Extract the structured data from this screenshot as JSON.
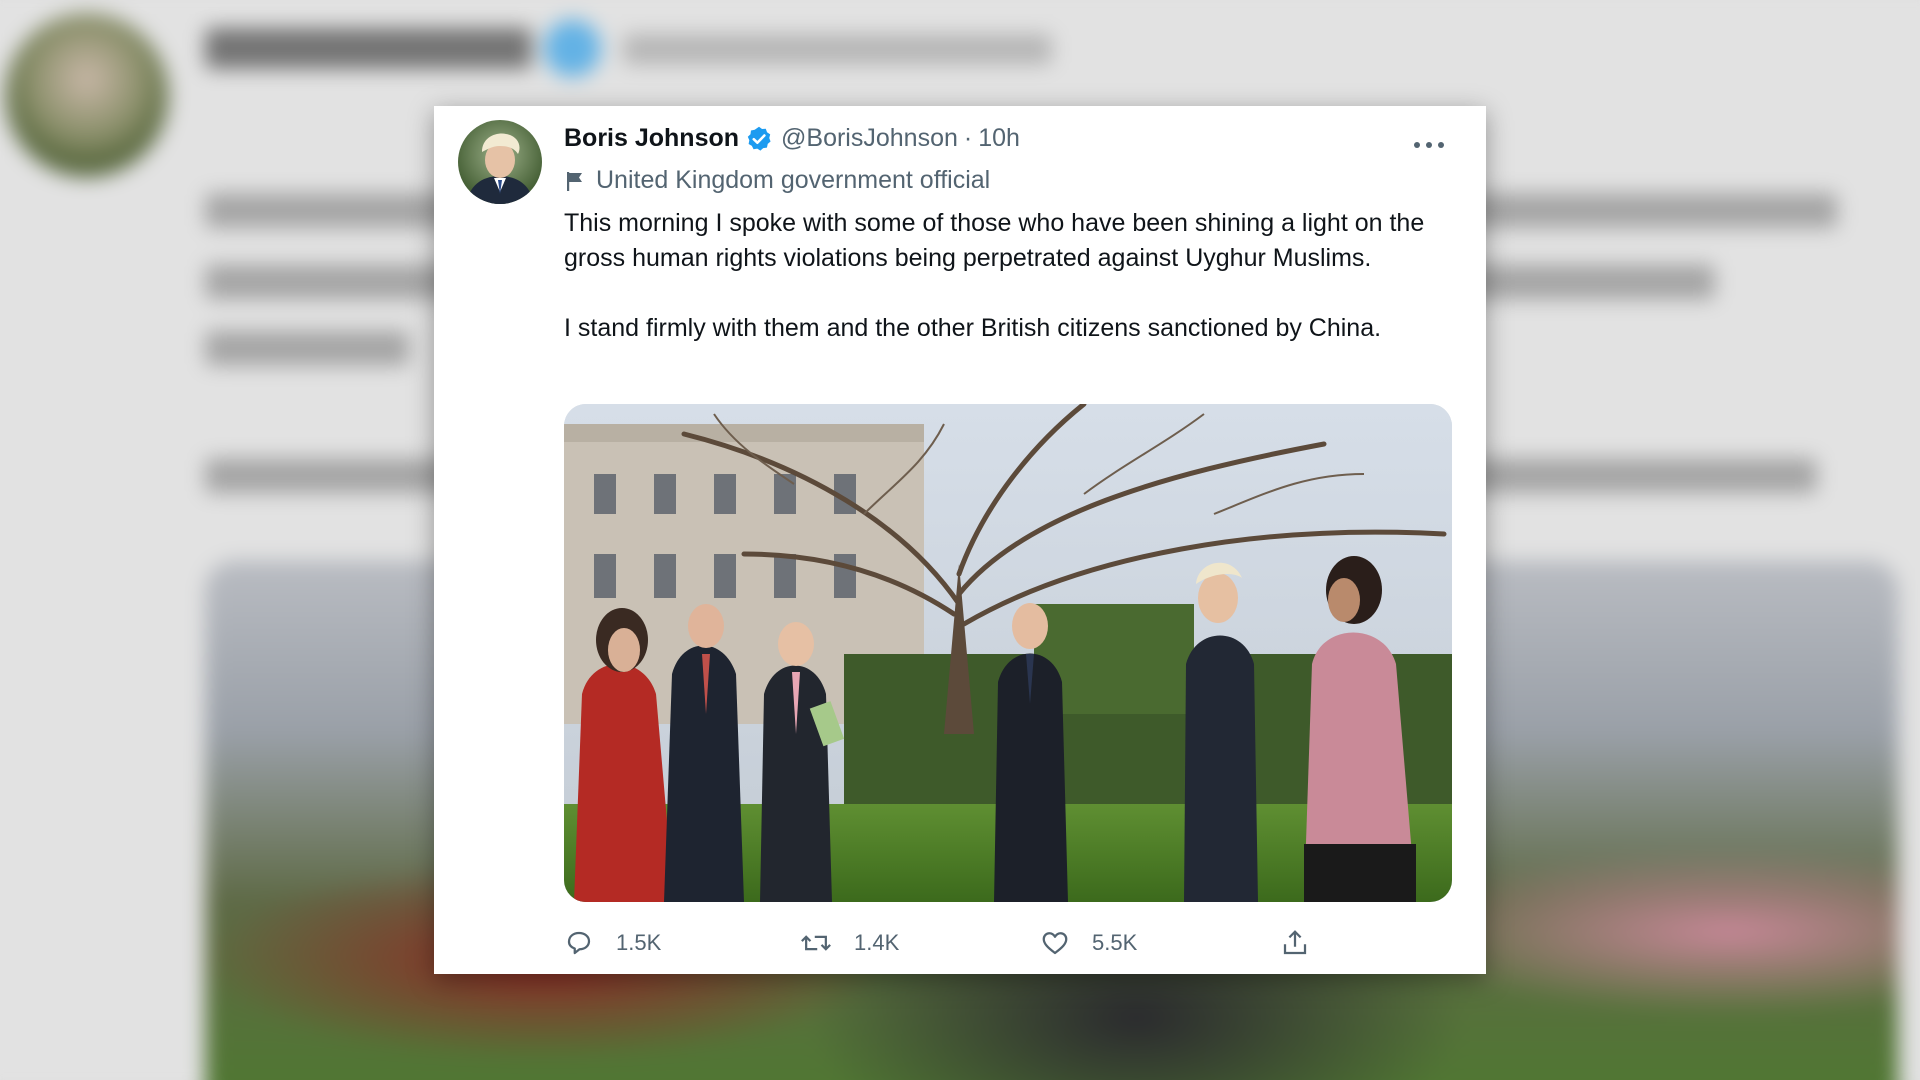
{
  "tweet": {
    "author_name": "Boris Johnson",
    "handle": "@BorisJohnson",
    "separator": "·",
    "time": "10h",
    "label": "United Kingdom government official",
    "paragraphs": [
      "This morning I spoke with some of those who have been shining a light on the gross human rights violations being perpetrated against Uyghur Muslims.",
      "I stand firmly with them and the other British citizens sanctioned by China."
    ],
    "stats": {
      "replies": "1.5K",
      "retweets": "1.4K",
      "likes": "5.5K"
    }
  },
  "colors": {
    "verified": "#1d9bf0",
    "text_primary": "#0f1419",
    "text_secondary": "#536471",
    "card_background": "#ffffff"
  },
  "icons": [
    "verified-badge-icon",
    "more-options-icon",
    "flag-icon",
    "reply-icon",
    "retweet-icon",
    "like-icon",
    "share-icon"
  ]
}
